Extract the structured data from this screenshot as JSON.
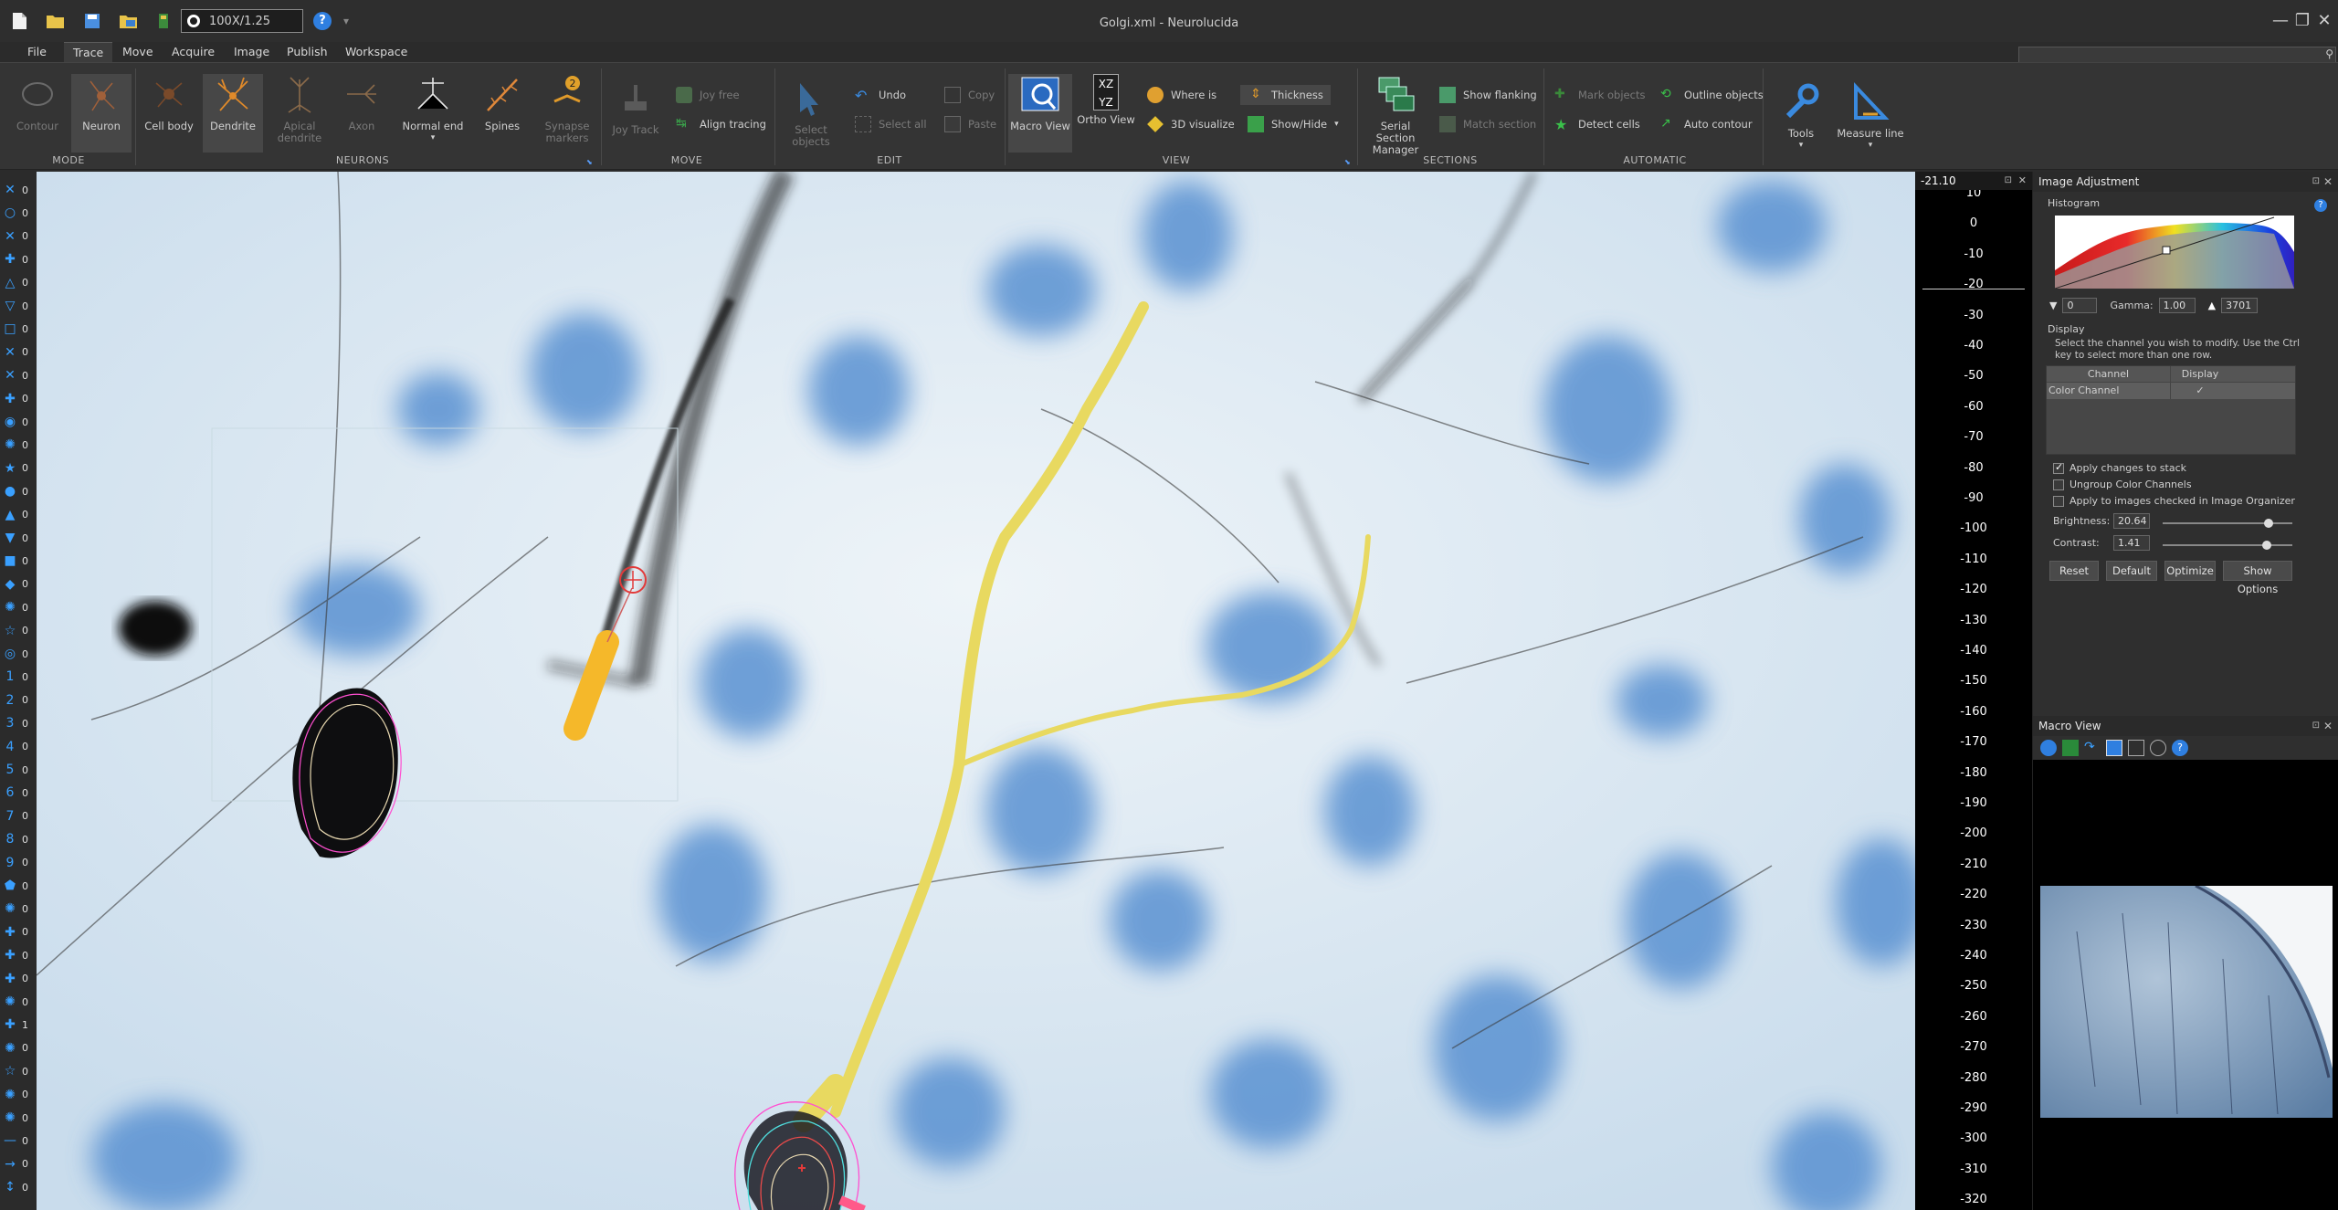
{
  "app": {
    "title": "Golgi.xml - Neurolucida",
    "zoom": "100X/1.25"
  },
  "menu": {
    "items": [
      "File",
      "Trace",
      "Move",
      "Acquire",
      "Image",
      "Publish",
      "Workspace"
    ],
    "active": "Trace"
  },
  "ribbon": {
    "groups": {
      "mode": "MODE",
      "neurons": "NEURONS",
      "move": "MOVE",
      "edit": "EDIT",
      "view": "VIEW",
      "sections": "SECTIONS",
      "automatic": "AUTOMATIC"
    },
    "mode": {
      "contour": "Contour",
      "neuron": "Neuron"
    },
    "neurons": {
      "cell_body": "Cell body",
      "dendrite": "Dendrite",
      "apical_1": "Apical",
      "apical_2": "dendrite",
      "axon": "Axon",
      "normal_end": "Normal end",
      "spines": "Spines",
      "synapse_1": "Synapse",
      "synapse_2": "markers",
      "synapse_badge": "2"
    },
    "move": {
      "joy_track": "Joy Track",
      "joy_free": "Joy free",
      "align_tracing": "Align tracing"
    },
    "edit": {
      "select_objects": "Select objects",
      "undo": "Undo",
      "select_all": "Select all",
      "copy": "Copy",
      "paste": "Paste"
    },
    "view": {
      "macro_view": "Macro View",
      "ortho_view": "Ortho View",
      "ortho_glyph_1": "XZ",
      "ortho_glyph_2": "YZ",
      "where_is": "Where is",
      "visualize_3d": "3D visualize",
      "thickness": "Thickness",
      "show_hide": "Show/Hide"
    },
    "sections": {
      "serial_1": "Serial Section",
      "serial_2": "Manager",
      "show_flanking": "Show flanking",
      "match_section": "Match section"
    },
    "automatic": {
      "mark_objects": "Mark objects",
      "outline_objects": "Outline objects",
      "detect_cells": "Detect cells",
      "auto_contour": "Auto contour"
    },
    "tools": "Tools",
    "measure_line": "Measure line"
  },
  "left_toolbar": {
    "counts": [
      "0",
      "0",
      "0",
      "0",
      "0",
      "0",
      "0",
      "0",
      "0",
      "0",
      "0",
      "0",
      "0",
      "0",
      "0",
      "0",
      "0",
      "0",
      "0",
      "0",
      "0",
      "0",
      "0",
      "0",
      "0",
      "0",
      "0",
      "0",
      "0",
      "0",
      "0",
      "0",
      "0",
      "0",
      "0",
      "0",
      "1",
      "0",
      "0",
      "0",
      "0",
      "0",
      "0",
      "0"
    ]
  },
  "z_ruler": {
    "current": "-21.10",
    "ticks": [
      "10",
      "0",
      "-10",
      "-20",
      "-30",
      "-40",
      "-50",
      "-60",
      "-70",
      "-80",
      "-90",
      "-100",
      "-110",
      "-120",
      "-130",
      "-140",
      "-150",
      "-160",
      "-170",
      "-180",
      "-190",
      "-200",
      "-210",
      "-220",
      "-230",
      "-240",
      "-250",
      "-260",
      "-270",
      "-280",
      "-290",
      "-300",
      "-310",
      "-320"
    ]
  },
  "image_adjustment": {
    "title": "Image Adjustment",
    "histogram_label": "Histogram",
    "black_value": "0",
    "gamma_label": "Gamma:",
    "gamma_value": "1.00",
    "white_value": "3701",
    "display_label": "Display",
    "display_hint": "Select the channel you wish to modify.  Use the Ctrl key to select more than one row.",
    "col_channel": "Channel",
    "col_display": "Display",
    "row_channel": "Color Channel",
    "row_display": "✓",
    "apply_stack": "Apply changes to stack",
    "ungroup": "Ungroup Color Channels",
    "apply_organizer": "Apply to images checked in Image Organizer",
    "brightness_label": "Brightness:",
    "brightness_value": "20.64",
    "brightness_level": 0.82,
    "contrast_label": "Contrast:",
    "contrast_value": "1.41",
    "contrast_level": 0.8,
    "reset": "Reset",
    "default": "Default",
    "optimize": "Optimize",
    "show_options": "Show Options"
  },
  "macro_view": {
    "title": "Macro View"
  },
  "colors": {
    "accent_blue": "#3aa0ff",
    "tracing_yellow": "#e8d960",
    "dendrite_orange": "#f5b82a",
    "marker_red": "#e23a3a"
  }
}
